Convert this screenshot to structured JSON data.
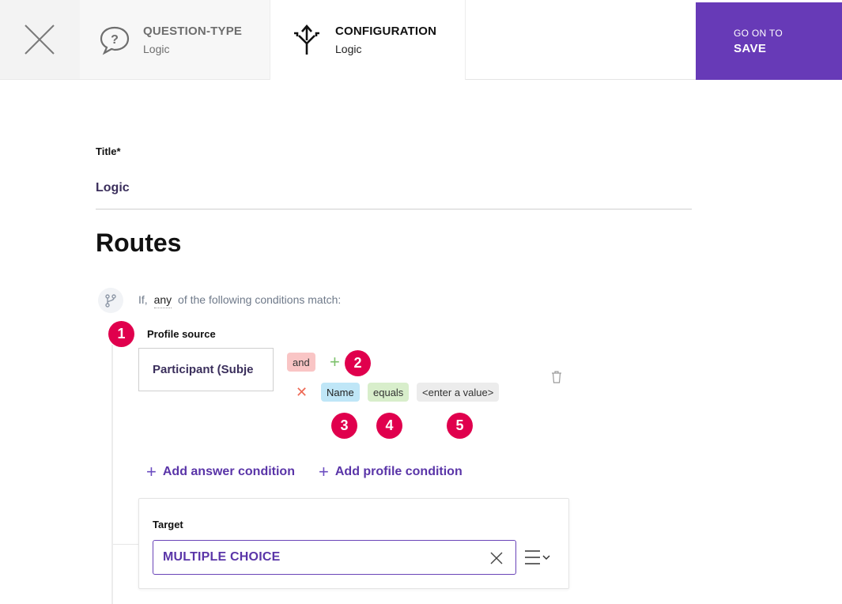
{
  "header": {
    "tabs": [
      {
        "title": "QUESTION-TYPE",
        "subtitle": "Logic",
        "icon": "question-bubble-icon"
      },
      {
        "title": "CONFIGURATION",
        "subtitle": "Logic",
        "icon": "split-arrows-icon"
      }
    ],
    "save": {
      "pre": "GO ON TO",
      "label": "SAVE"
    },
    "close_icon": "close-icon",
    "accent": "#673ab7"
  },
  "title_field": {
    "label": "Title*",
    "value": "Logic"
  },
  "routes": {
    "heading": "Routes",
    "condition_line": {
      "prefix": "If,",
      "mode": "any",
      "suffix": "of the following conditions match:"
    },
    "profile_source_label": "Profile source",
    "profile_source_value": "Participant (Subje",
    "operator_chip": "and",
    "condition": {
      "field": "Name",
      "comparator": "equals",
      "value_placeholder": "<enter a value>"
    },
    "badges": [
      "1",
      "2",
      "3",
      "4",
      "5"
    ],
    "badge_color": "#e0004d",
    "add_answer_condition": "Add answer condition",
    "add_profile_condition": "Add profile condition",
    "target": {
      "label": "Target",
      "value": "MULTIPLE CHOICE"
    }
  }
}
